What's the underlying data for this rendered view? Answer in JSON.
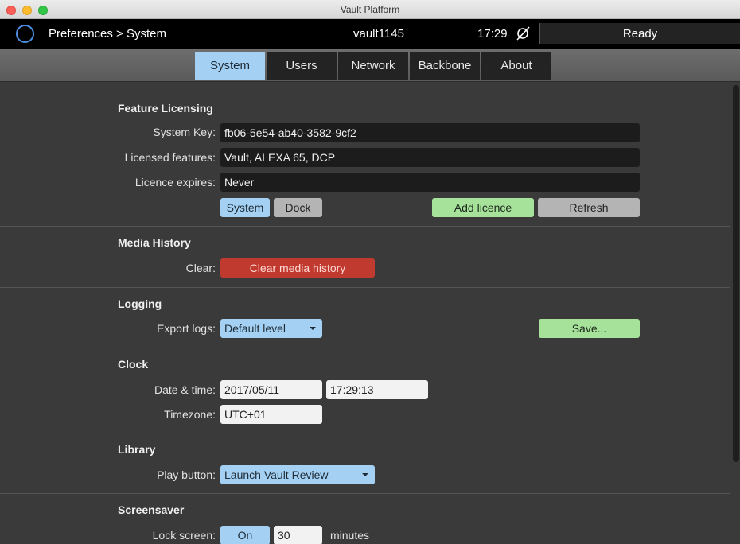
{
  "window": {
    "title": "Vault Platform"
  },
  "header": {
    "breadcrumb": "Preferences > System",
    "hostname": "vault1145",
    "time": "17:29",
    "status": "Ready",
    "icons": {
      "logo": "ring-logo-icon",
      "sync": "sync-disabled-icon"
    },
    "accent_color": "#4c8fe0"
  },
  "tabs": [
    {
      "label": "System",
      "active": true
    },
    {
      "label": "Users",
      "active": false
    },
    {
      "label": "Network",
      "active": false
    },
    {
      "label": "Backbone",
      "active": false
    },
    {
      "label": "About",
      "active": false
    }
  ],
  "licensing": {
    "title": "Feature Licensing",
    "system_key_label": "System Key:",
    "system_key": "fb06-5e54-ab40-3582-9cf2",
    "features_label": "Licensed features:",
    "features": "Vault, ALEXA 65, DCP",
    "expires_label": "Licence expires:",
    "expires": "Never",
    "toggle_system": "System",
    "toggle_dock": "Dock",
    "add_licence": "Add licence",
    "refresh": "Refresh"
  },
  "media_history": {
    "title": "Media History",
    "clear_label": "Clear:",
    "clear_button": "Clear media history"
  },
  "logging": {
    "title": "Logging",
    "export_label": "Export logs:",
    "level": "Default level",
    "save": "Save..."
  },
  "clock": {
    "title": "Clock",
    "datetime_label": "Date & time:",
    "date": "2017/05/11",
    "time": "17:29:13",
    "timezone_label": "Timezone:",
    "timezone": "UTC+01"
  },
  "library": {
    "title": "Library",
    "play_label": "Play button:",
    "play_value": "Launch Vault Review"
  },
  "screensaver": {
    "title": "Screensaver",
    "lock_label": "Lock screen:",
    "lock_state": "On",
    "minutes_value": "30",
    "minutes_unit": "minutes"
  },
  "colors": {
    "active_tab": "#a4d1f3",
    "positive_button": "#a6e29a",
    "danger_button": "#c03a2f"
  }
}
